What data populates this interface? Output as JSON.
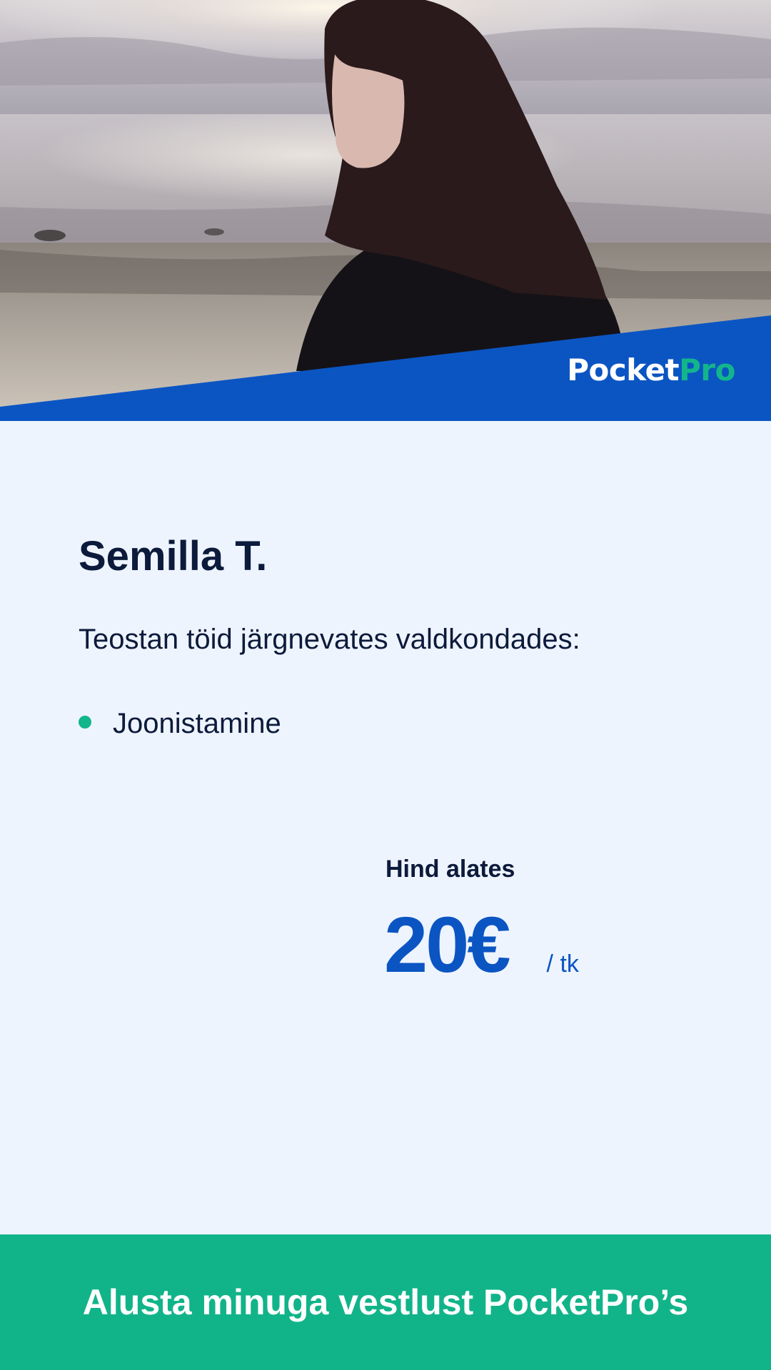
{
  "brand": {
    "logo_part_1": "Pocket",
    "logo_part_2": "Pro",
    "accent_blue": "#0b55c3",
    "accent_green": "#13b58b",
    "background": "#eef4fe"
  },
  "profile": {
    "name": "Semilla T.",
    "intro": "Teostan töid järgnevates valdkondades:",
    "skills": [
      "Joonistamine"
    ]
  },
  "price": {
    "label": "Hind alates",
    "amount": "20",
    "currency": "€",
    "unit": "/ tk"
  },
  "cta": {
    "label": "Alusta minuga vestlust PocketPro’s"
  }
}
